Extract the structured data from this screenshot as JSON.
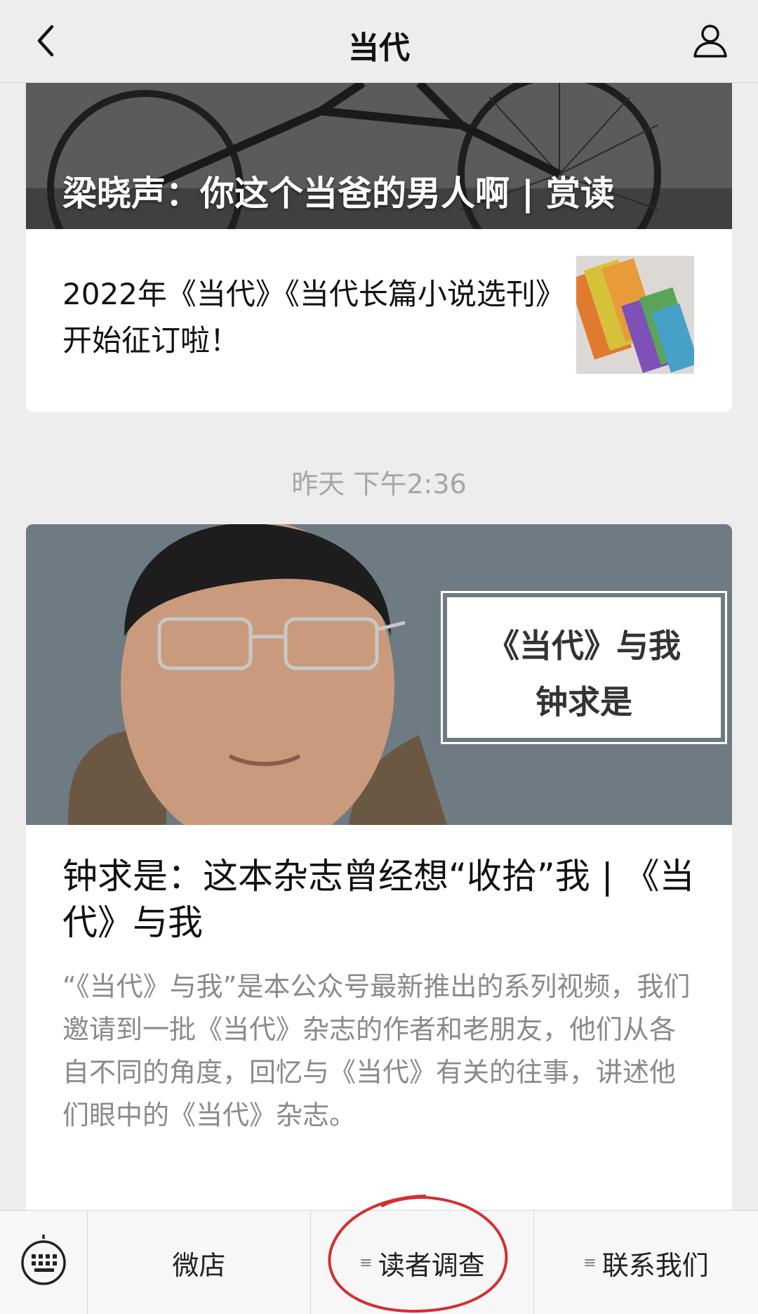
{
  "nav": {
    "title": "当代",
    "back_icon": "chevron-left-icon",
    "profile_icon": "person-icon"
  },
  "feed": {
    "card1": {
      "cover_title": "梁晓声：你这个当爸的男人啊 | 赏读",
      "row_title": "2022年《当代》《当代长篇小说选刊》开始征订啦！"
    },
    "timestamp": "昨天 下午2:36",
    "card2": {
      "cover_label_line1": "《当代》与我",
      "cover_label_line2": "钟求是",
      "title": "钟求是：这本杂志曾经想“收拾”我 | 《当代》与我",
      "description": "“《当代》与我”是本公众号最新推出的系列视频，我们邀请到一批《当代》杂志的作者和老朋友，他们从各自不同的角度，回忆与《当代》有关的往事，讲述他们眼中的《当代》杂志。"
    }
  },
  "menu": {
    "keyboard_icon": "keyboard-icon",
    "items": [
      {
        "label": "微店",
        "has_submenu": false
      },
      {
        "label": "读者调查",
        "has_submenu": true
      },
      {
        "label": "联系我们",
        "has_submenu": true
      }
    ],
    "submenu_icon": "≡"
  },
  "colors": {
    "background": "#ededed",
    "annotation": "#d32f2f"
  }
}
